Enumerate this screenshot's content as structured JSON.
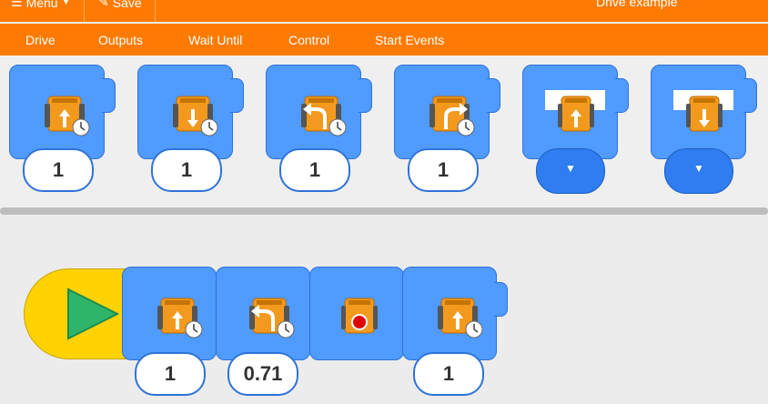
{
  "topbar": {
    "menu_label": "Menu",
    "save_label": "Save",
    "title": "Drive example"
  },
  "categories": [
    "Drive",
    "Outputs",
    "Wait Until",
    "Control",
    "Start Events"
  ],
  "palette": [
    {
      "icon": "drive-forward-timed-icon",
      "value": "1"
    },
    {
      "icon": "drive-backward-timed-icon",
      "value": "1"
    },
    {
      "icon": "turn-left-timed-icon",
      "value": "1"
    },
    {
      "icon": "turn-right-timed-icon",
      "value": "1"
    },
    {
      "icon": "drive-forward-until-icon",
      "value": ""
    },
    {
      "icon": "drive-backward-until-icon",
      "value": ""
    }
  ],
  "workspace": [
    {
      "icon": "drive-forward-timed-icon",
      "value": "1"
    },
    {
      "icon": "turn-left-timed-icon",
      "value": "0.71"
    },
    {
      "icon": "stop-icon",
      "value": ""
    },
    {
      "icon": "drive-forward-timed-icon",
      "value": "1"
    }
  ],
  "colors": {
    "orange": "#ff7a00",
    "block_blue": "#4f9bff",
    "start_yellow": "#ffd200",
    "play_green": "#2fb56a"
  }
}
